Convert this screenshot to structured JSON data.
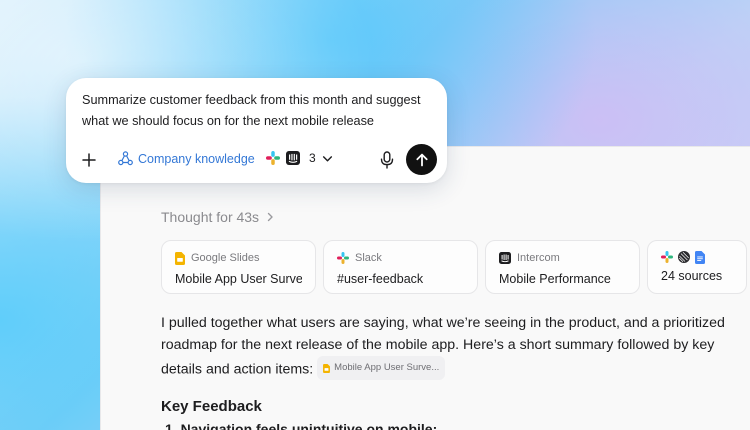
{
  "prompt": {
    "text": "Summarize customer feedback from this month and suggest what we should focus on for the next mobile release",
    "company_knowledge_label": "Company knowledge",
    "app_count": "3"
  },
  "response": {
    "thought_label": "Thought for 43s",
    "sources": [
      {
        "app": "Google Slides",
        "title": "Mobile App User Surve...",
        "icon": "google-slides-icon"
      },
      {
        "app": "Slack",
        "title": "#user-feedback",
        "icon": "slack-icon"
      },
      {
        "app": "Intercom",
        "title": "Mobile Performance",
        "icon": "intercom-icon"
      },
      {
        "app": "",
        "title": "24 sources",
        "icon": "multi-source-icons"
      }
    ],
    "paragraph": "I pulled together what users are saying, what we’re seeing in the product, and a prioritized roadmap for the next release of the mobile app. Here’s a short summary followed by key details and action items:",
    "citation_chip": "Mobile App User Surve...",
    "heading": "Key Feedback",
    "list_item_1": "1.  Navigation feels unintuitive on mobile:"
  },
  "colors": {
    "accent_blue": "#3478d6",
    "send_button": "#111111",
    "google_slides": "#f4b400",
    "google_docs": "#4285f4"
  }
}
